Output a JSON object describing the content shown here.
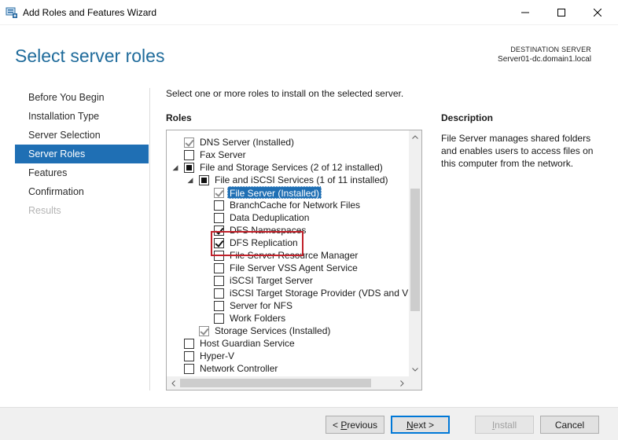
{
  "window": {
    "title": "Add Roles and Features Wizard",
    "icon": "server-manager-icon"
  },
  "header": {
    "page_title": "Select server roles",
    "destination_label": "DESTINATION SERVER",
    "destination_value": "Server01-dc.domain1.local"
  },
  "nav": {
    "items": [
      {
        "label": "Before You Begin",
        "state": "normal"
      },
      {
        "label": "Installation Type",
        "state": "normal"
      },
      {
        "label": "Server Selection",
        "state": "normal"
      },
      {
        "label": "Server Roles",
        "state": "active"
      },
      {
        "label": "Features",
        "state": "normal"
      },
      {
        "label": "Confirmation",
        "state": "normal"
      },
      {
        "label": "Results",
        "state": "disabled"
      }
    ]
  },
  "main": {
    "instruction": "Select one or more roles to install on the selected server.",
    "roles_heading": "Roles",
    "roles": [
      {
        "label": "DNS Server (Installed)",
        "state": "installed"
      },
      {
        "label": "Fax Server",
        "state": "unchecked"
      },
      {
        "label": "File and Storage Services (2 of 12 installed)",
        "state": "partial",
        "expander": "expanded"
      },
      {
        "label": "File and iSCSI Services (1 of 11 installed)",
        "state": "partial",
        "expander": "expanded"
      },
      {
        "label": "File Server (Installed)",
        "state": "installed",
        "selected": true
      },
      {
        "label": "BranchCache for Network Files",
        "state": "unchecked"
      },
      {
        "label": "Data Deduplication",
        "state": "unchecked"
      },
      {
        "label": "DFS Namespaces",
        "state": "checked"
      },
      {
        "label": "DFS Replication",
        "state": "checked"
      },
      {
        "label": "File Server Resource Manager",
        "state": "unchecked"
      },
      {
        "label": "File Server VSS Agent Service",
        "state": "unchecked"
      },
      {
        "label": "iSCSI Target Server",
        "state": "unchecked"
      },
      {
        "label": "iSCSI Target Storage Provider (VDS and VSS",
        "state": "unchecked"
      },
      {
        "label": "Server for NFS",
        "state": "unchecked"
      },
      {
        "label": "Work Folders",
        "state": "unchecked"
      },
      {
        "label": "Storage Services (Installed)",
        "state": "installed"
      },
      {
        "label": "Host Guardian Service",
        "state": "unchecked"
      },
      {
        "label": "Hyper-V",
        "state": "unchecked"
      },
      {
        "label": "Network Controller",
        "state": "unchecked"
      }
    ]
  },
  "description": {
    "heading": "Description",
    "text": "File Server manages shared folders and enables users to access files on this computer from the network."
  },
  "footer": {
    "previous": {
      "prefix": "< ",
      "accel": "P",
      "rest": "revious"
    },
    "next": {
      "accel": "N",
      "rest": "ext",
      "suffix": " >"
    },
    "install": {
      "accel": "I",
      "rest": "nstall"
    },
    "cancel": "Cancel"
  },
  "colors": {
    "accent": "#1f6fb4",
    "title": "#1f6b9b",
    "highlight": "#c0212a"
  }
}
